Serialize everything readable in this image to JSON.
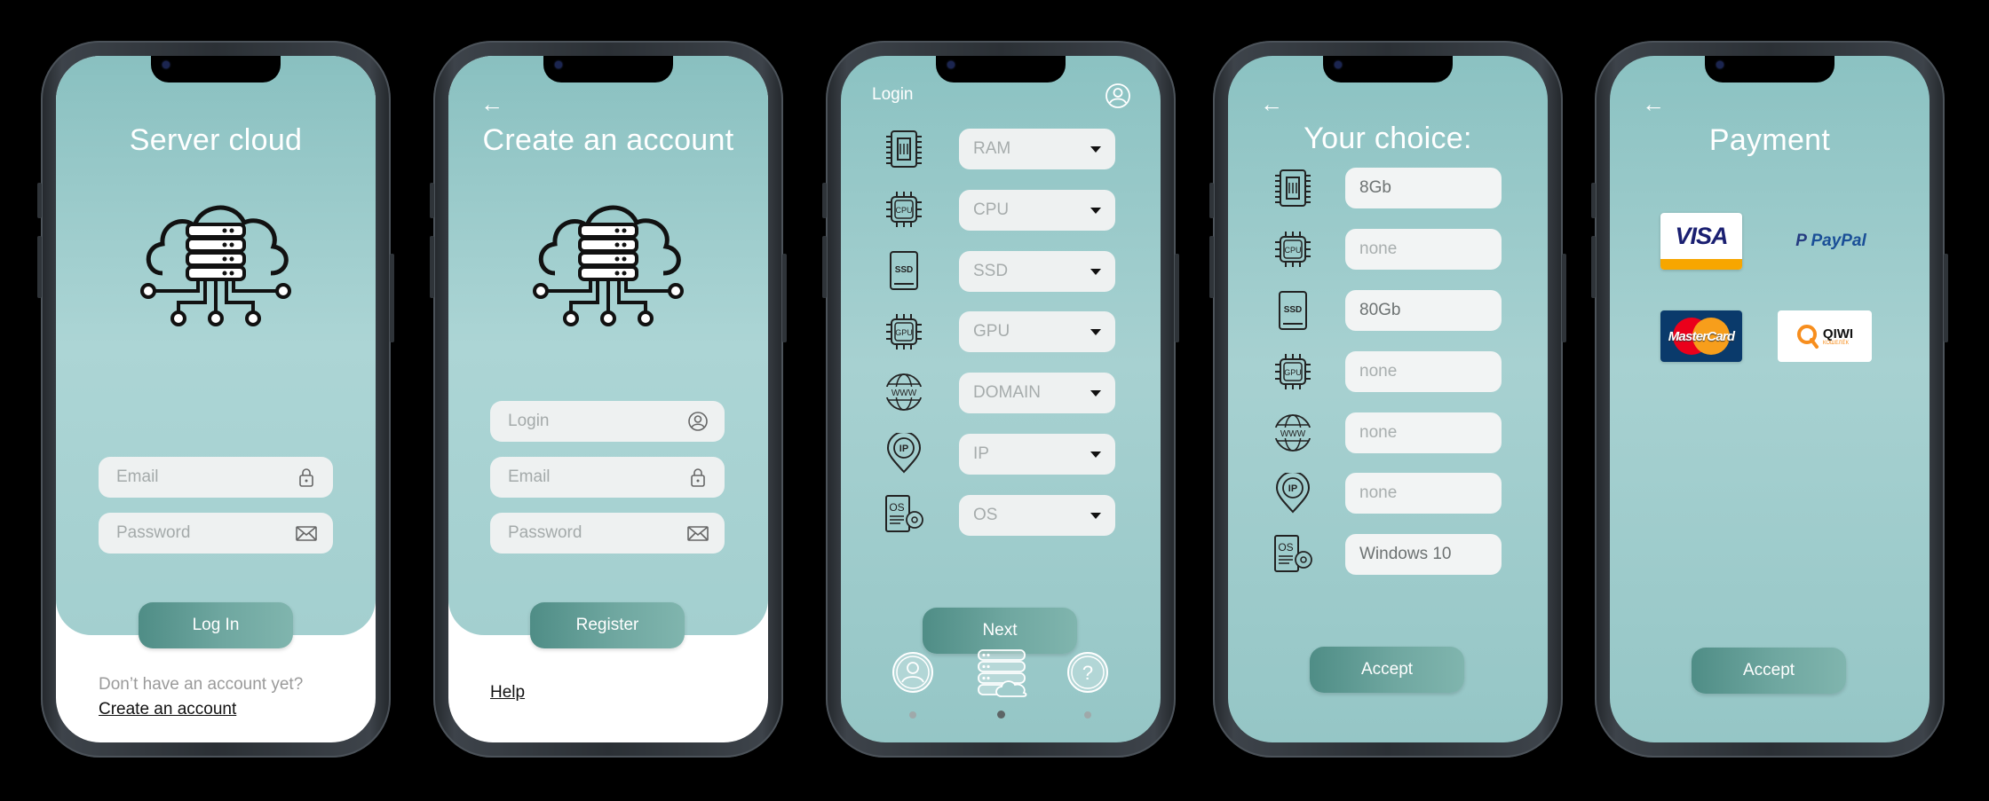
{
  "screen1": {
    "title": "Server cloud",
    "email_placeholder": "Email",
    "password_placeholder": "Password",
    "login_button": "Log In",
    "no_account_text": "Don’t have an account yet?",
    "create_account_link": "Create an account"
  },
  "screen2": {
    "back": "←",
    "title": "Create an account",
    "login_placeholder": "Login",
    "email_placeholder": "Email",
    "password_placeholder": "Password",
    "register_button": "Register",
    "help_link": "Help"
  },
  "screen3": {
    "header": "Login",
    "rows": [
      {
        "icon": "ram-chip-icon",
        "label": "RAM"
      },
      {
        "icon": "cpu-chip-icon",
        "label": "CPU"
      },
      {
        "icon": "ssd-icon",
        "label": "SSD"
      },
      {
        "icon": "gpu-chip-icon",
        "label": "GPU"
      },
      {
        "icon": "globe-www-icon",
        "label": "DOMAIN"
      },
      {
        "icon": "ip-pin-icon",
        "label": "IP"
      },
      {
        "icon": "os-disc-icon",
        "label": "OS"
      }
    ],
    "next_button": "Next",
    "nav": [
      "user-icon",
      "server-cloud-icon",
      "help-icon"
    ],
    "active_page": 2,
    "page_count": 3
  },
  "screen4": {
    "back": "←",
    "title": "Your choice:",
    "values": [
      "8Gb",
      "none",
      "80Gb",
      "none",
      "none",
      "none",
      "Windows 10"
    ],
    "accept_button": "Accept"
  },
  "screen5": {
    "back": "←",
    "title": "Payment",
    "methods": {
      "visa": "VISA",
      "paypal": "PayPal",
      "mastercard": "MasterCard",
      "qiwi": "QIWI",
      "qiwi_sub": "КОШЕЛЁК"
    },
    "accept_button": "Accept"
  },
  "colors": {
    "teal_light": "#acd5d5",
    "teal": "#89c0c0",
    "button": "#5e9a93",
    "field": "#eef1f1"
  }
}
